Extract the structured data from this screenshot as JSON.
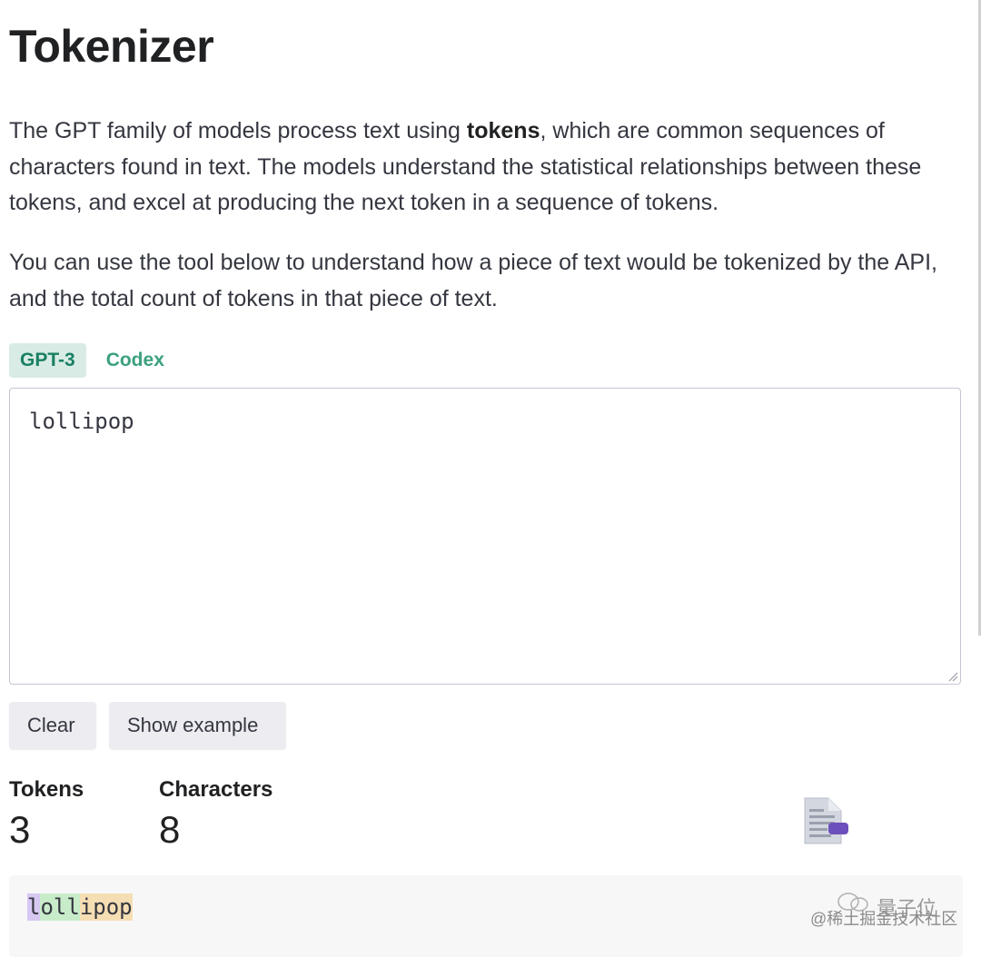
{
  "page": {
    "title": "Tokenizer"
  },
  "intro": {
    "p1_before": "The GPT family of models process text using ",
    "p1_bold": "tokens",
    "p1_after": ", which are common sequences of characters found in text. The models understand the statistical relationships between these tokens, and excel at producing the next token in a sequence of tokens.",
    "p2": "You can use the tool below to understand how a piece of text would be tokenized by the API, and the total count of tokens in that piece of text."
  },
  "tabs": [
    {
      "label": "GPT-3",
      "active": true
    },
    {
      "label": "Codex",
      "active": false
    }
  ],
  "editor": {
    "value": "lollipop"
  },
  "buttons": {
    "clear": "Clear",
    "show_example": "Show example"
  },
  "stats": {
    "tokens_label": "Tokens",
    "tokens_value": "3",
    "characters_label": "Characters",
    "characters_value": "8"
  },
  "output": {
    "tokens": [
      {
        "text": "l",
        "color": "#d6c8f1"
      },
      {
        "text": "oll",
        "color": "#c8ecc9"
      },
      {
        "text": "ipop",
        "color": "#f6deb4"
      }
    ]
  },
  "watermark": {
    "text": "@稀土掘金技术社区",
    "mark": "量子位"
  },
  "colors": {
    "accent": "#10a37f",
    "tab_active_bg": "#d8ece5",
    "button_bg": "#ececf1",
    "output_bg": "#f7f7f8"
  },
  "icons": {
    "document_icon": "document-icon",
    "resize_grip": "resize-grip-icon"
  }
}
